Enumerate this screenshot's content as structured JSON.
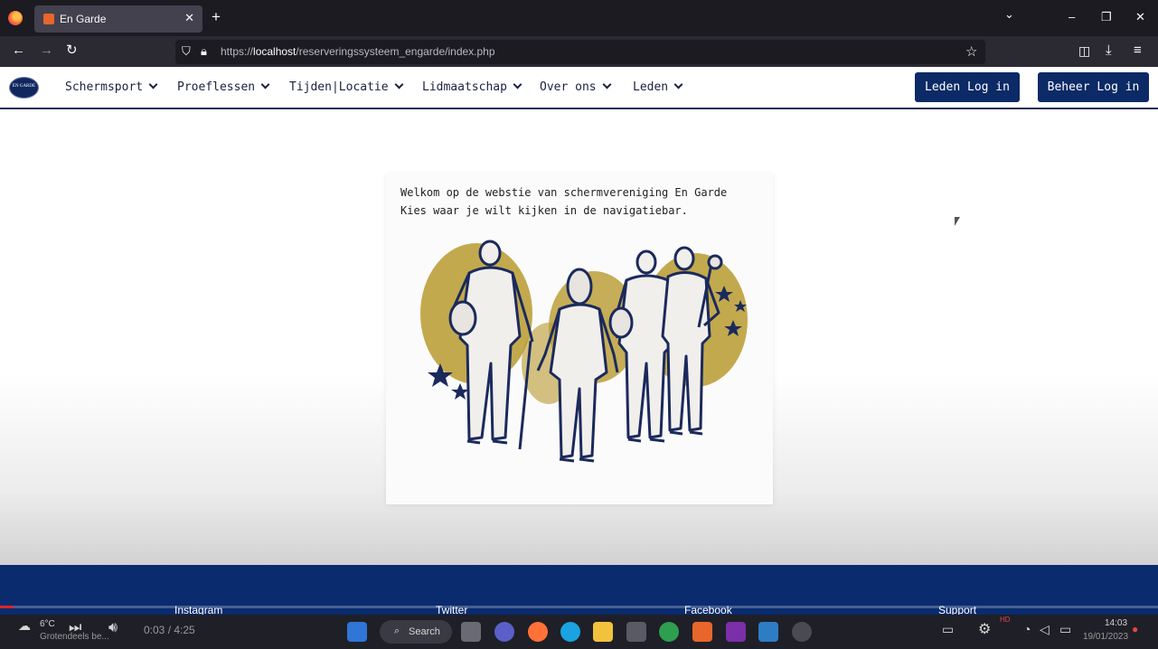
{
  "browser": {
    "tab_title": "En Garde",
    "tab_close": "✕",
    "new_tab": "+",
    "url_prefix": "https://",
    "url_host": "localhost",
    "url_path": "/reserveringssysteem_engarde/index.php",
    "nav": {
      "back": "←",
      "forward": "→",
      "reload": "↻"
    },
    "window": {
      "list": "⌄",
      "minimize": "–",
      "restore": "❐",
      "close": "✕"
    },
    "toolbar": {
      "star": "☆",
      "pocket": "◫",
      "download": "⤓",
      "menu": "≡"
    }
  },
  "site": {
    "logo_text": "EN GARDE",
    "menu": [
      {
        "label": "Schermsport"
      },
      {
        "label": "Proeflessen"
      },
      {
        "label": "Tijden|Locatie"
      },
      {
        "label": "Lidmaatschap"
      },
      {
        "label": "Over ons"
      },
      {
        "label": "Leden"
      }
    ],
    "leden_login": "Leden Log in",
    "beheer_login": "Beheer Log in",
    "welcome_line1": "Welkom op de webstie van schermvereniging En Garde",
    "welcome_line2": "Kies waar je wilt kijken in de navigatiebar.",
    "footer": [
      "Instagram",
      "Twitter",
      "Facebook",
      "Support"
    ]
  },
  "colors": {
    "primary": "#0b2a66",
    "gold": "#b99a2e",
    "ink": "#1b2a5c"
  },
  "video": {
    "time": "0:03 / 4:25",
    "progress": 0.0118
  },
  "taskbar": {
    "weather_temp": "6°C",
    "weather_desc": "Grotendeels be...",
    "search": "Search",
    "clock_time": "14:03",
    "clock_date": "19/01/2023",
    "badge": "HD"
  }
}
